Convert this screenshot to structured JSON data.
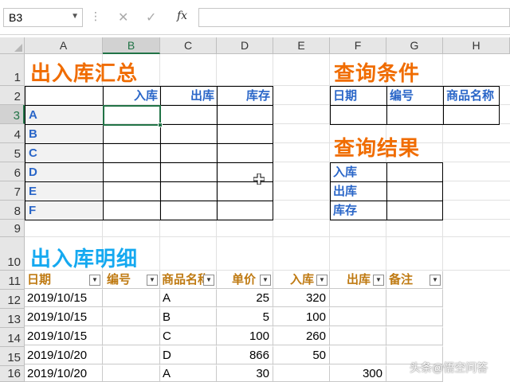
{
  "formula_bar": {
    "name_box": "B3",
    "cancel": "✕",
    "confirm": "✓",
    "fx": "fx",
    "formula": ""
  },
  "columns": [
    "A",
    "B",
    "C",
    "D",
    "E",
    "F",
    "G",
    "H"
  ],
  "rows": [
    "1",
    "2",
    "3",
    "4",
    "5",
    "6",
    "7",
    "8",
    "9",
    "10",
    "11",
    "12",
    "13",
    "14",
    "15",
    "16"
  ],
  "selection": {
    "cell": "B3",
    "column": "B",
    "row": "3"
  },
  "summary": {
    "title": "出入库汇总",
    "headers": [
      "入库",
      "出库",
      "库存"
    ],
    "items": [
      "A",
      "B",
      "C",
      "D",
      "E",
      "F"
    ]
  },
  "query": {
    "title": "查询条件",
    "headers": [
      "日期",
      "编号",
      "商品名称"
    ]
  },
  "result": {
    "title": "查询结果",
    "labels": [
      "入库",
      "出库",
      "库存"
    ]
  },
  "detail": {
    "title": "出入库明细",
    "headers": [
      "日期",
      "编号",
      "商品名称",
      "单价",
      "入库",
      "出库",
      "备注"
    ],
    "rows": [
      {
        "date": "2019/10/15",
        "code": "",
        "name": "A",
        "price": "25",
        "in": "320",
        "out": "",
        "note": ""
      },
      {
        "date": "2019/10/15",
        "code": "",
        "name": "B",
        "price": "5",
        "in": "100",
        "out": "",
        "note": ""
      },
      {
        "date": "2019/10/15",
        "code": "",
        "name": "C",
        "price": "100",
        "in": "260",
        "out": "",
        "note": ""
      },
      {
        "date": "2019/10/20",
        "code": "",
        "name": "D",
        "price": "866",
        "in": "50",
        "out": "",
        "note": ""
      },
      {
        "date": "2019/10/20",
        "code": "",
        "name": "A",
        "price": "30",
        "in": "",
        "out": "300",
        "note": ""
      }
    ]
  },
  "watermark": "头条@悟空问答",
  "colors": {
    "orange_title": "#f06c00",
    "blue_title": "#15a9f0",
    "header_blue": "#2a66c8",
    "detail_header": "#bf7a12",
    "excel_green": "#217346"
  }
}
